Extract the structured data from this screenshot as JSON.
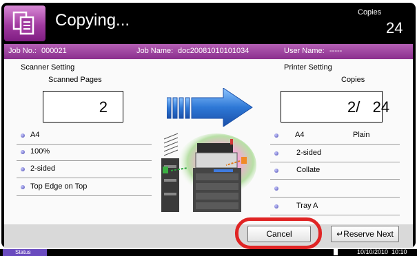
{
  "header": {
    "title": "Copying...",
    "copies_label": "Copies",
    "copies_value": "24"
  },
  "info_bar": {
    "job_no_label": "Job No.:",
    "job_no_value": "000021",
    "job_name_label": "Job Name:",
    "job_name_value": "doc20081010101034",
    "user_name_label": "User Name:",
    "user_name_value": "-----"
  },
  "scanner": {
    "section_title": "Scanner Setting",
    "scanned_label": "Scanned Pages",
    "scanned_value": "2",
    "settings": [
      "A4",
      "100%",
      "2-sided",
      "Top Edge on Top"
    ]
  },
  "printer": {
    "section_title": "Printer Setting",
    "copies_label": "Copies",
    "copies_value": "2/   24",
    "settings": [
      {
        "label": "A4",
        "extra": "Plain"
      },
      {
        "label": "2-sided",
        "extra": ""
      },
      {
        "label": "Collate",
        "extra": ""
      },
      {
        "label": "",
        "extra": ""
      },
      {
        "label": "Tray A",
        "extra": ""
      }
    ]
  },
  "buttons": {
    "cancel": "Cancel",
    "reserve_next": "Reserve Next"
  },
  "status_bar": {
    "status_label": "Status",
    "datetime": "10/10/2010  10:10"
  },
  "colors": {
    "accent_purple": "#8a2e8d",
    "arrow_blue": "#2e78d6",
    "highlight_red": "#e02424"
  }
}
